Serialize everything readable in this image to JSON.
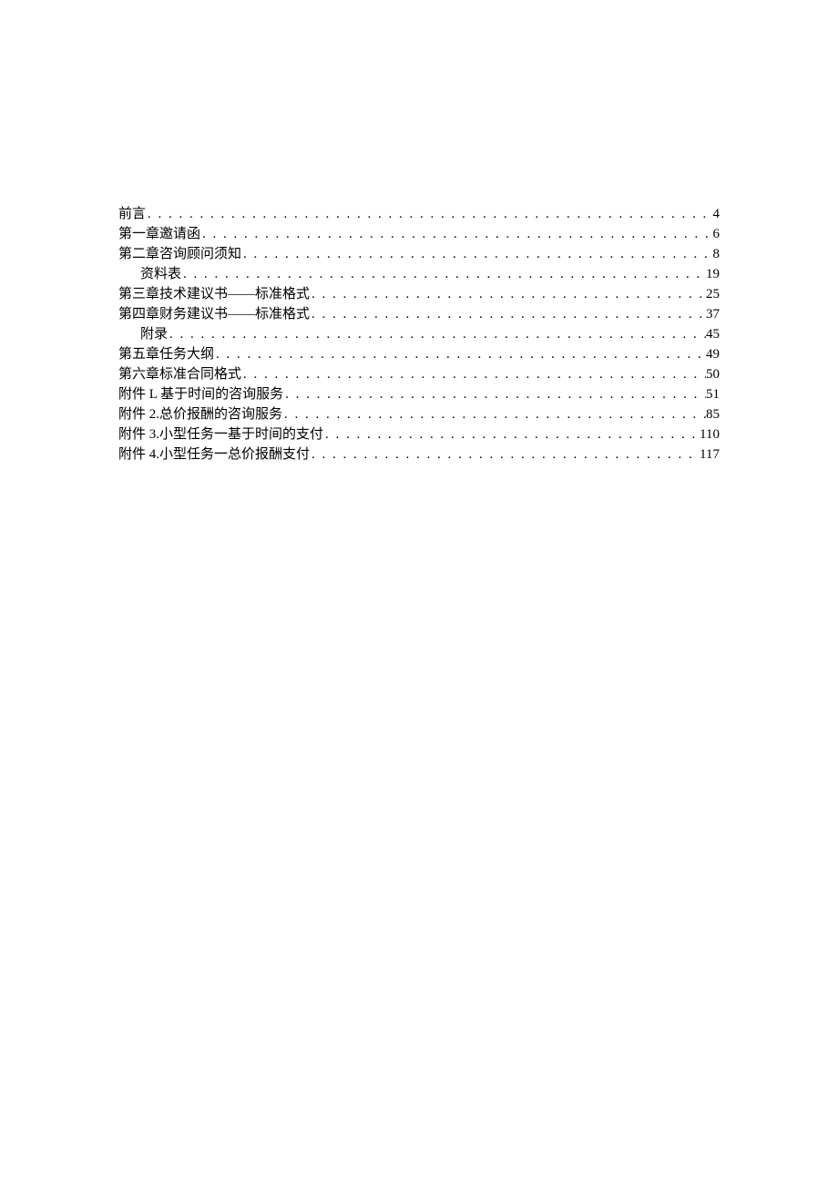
{
  "toc": {
    "entries": [
      {
        "title": "前言",
        "page": "4",
        "indent": 0
      },
      {
        "title": "第一章邀请函",
        "page": "6",
        "indent": 0
      },
      {
        "title": "第二章咨询顾问须知",
        "page": "8",
        "indent": 0
      },
      {
        "title": "资料表",
        "page": "19",
        "indent": 1
      },
      {
        "title": "第三章技术建议书——标准格式",
        "page": "25",
        "indent": 0
      },
      {
        "title": "第四章财务建议书——标准格式",
        "page": "37",
        "indent": 0
      },
      {
        "title": "附录",
        "page": "45",
        "indent": 1
      },
      {
        "title": "第五章任务大纲",
        "page": "49",
        "indent": 0
      },
      {
        "title": "第六章标准合同格式",
        "page": "50",
        "indent": 0
      },
      {
        "title": "附件 L 基于时间的咨询服务",
        "page": "51",
        "indent": 0
      },
      {
        "title": "附件 2.总价报酬的咨询服务",
        "page": "85",
        "indent": 0
      },
      {
        "title": "附件 3.小型任务一基于时间的支付",
        "page": "110",
        "indent": 0
      },
      {
        "title": "附件 4.小型任务一总价报酬支付",
        "page": "117",
        "indent": 0
      }
    ]
  }
}
